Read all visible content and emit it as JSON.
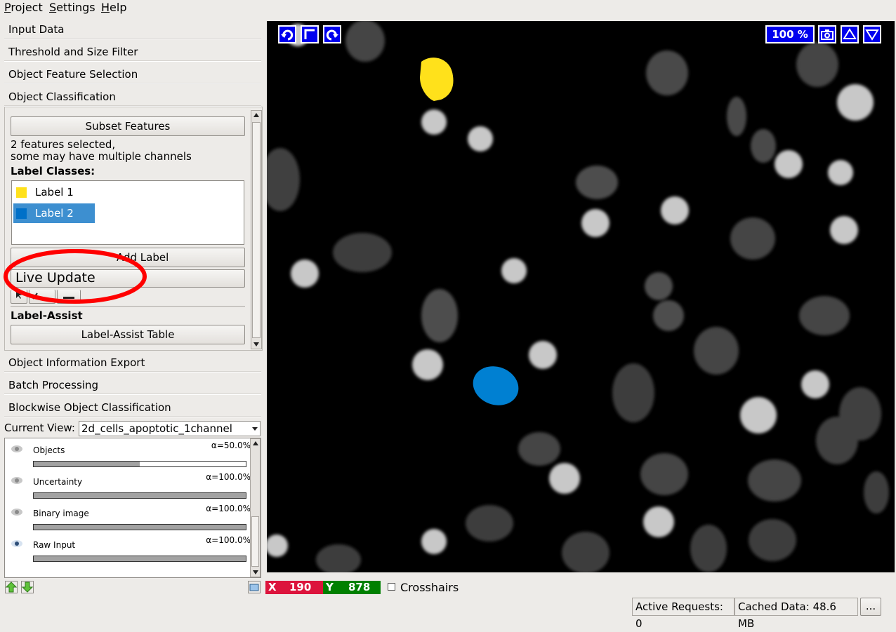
{
  "menu": {
    "project": "Project",
    "settings": "Settings",
    "help": "Help"
  },
  "applets": {
    "input_data": "Input Data",
    "threshold": "Threshold and Size Filter",
    "feature_selection": "Object Feature Selection",
    "classification": "Object Classification",
    "info_export": "Object Information Export",
    "batch": "Batch Processing",
    "blockwise": "Blockwise Object Classification"
  },
  "classification": {
    "subset_features": "Subset Features",
    "features_line1": "2 features selected,",
    "features_line2": "some may have multiple channels",
    "label_classes": "Label Classes:",
    "labels": [
      {
        "name": "Label 1",
        "color": "#ffe11b"
      },
      {
        "name": "Label 2",
        "color": "#0080d2"
      }
    ],
    "add_label": "Add Label",
    "live_update": "Live Update",
    "label_assist_header": "Label-Assist",
    "label_assist_table": "Label-Assist Table"
  },
  "current_view": {
    "label": "Current View:",
    "value": "2d_cells_apoptotic_1channel"
  },
  "layers": [
    {
      "name": "Objects",
      "alpha": "α=50.0%",
      "opacity": 0.5,
      "visible": false
    },
    {
      "name": "Uncertainty",
      "alpha": "α=100.0%",
      "opacity": 1.0,
      "visible": false
    },
    {
      "name": "Binary image",
      "alpha": "α=100.0%",
      "opacity": 1.0,
      "visible": false
    },
    {
      "name": "Raw Input",
      "alpha": "α=100.0%",
      "opacity": 1.0,
      "visible": true
    }
  ],
  "viewer": {
    "zoom": "100 %"
  },
  "coords": {
    "x_label": "X",
    "x_value": "190",
    "y_label": "Y",
    "y_value": "878",
    "crosshairs": "Crosshairs"
  },
  "status": {
    "active_requests": "Active Requests: 0",
    "cached_data": "Cached Data: 48.6 MB",
    "more": "..."
  },
  "colors": {
    "highlight_circle": "#ff0000",
    "viewer_button": "#0000ee",
    "x_badge": "#dc143c",
    "y_badge": "#008000"
  }
}
